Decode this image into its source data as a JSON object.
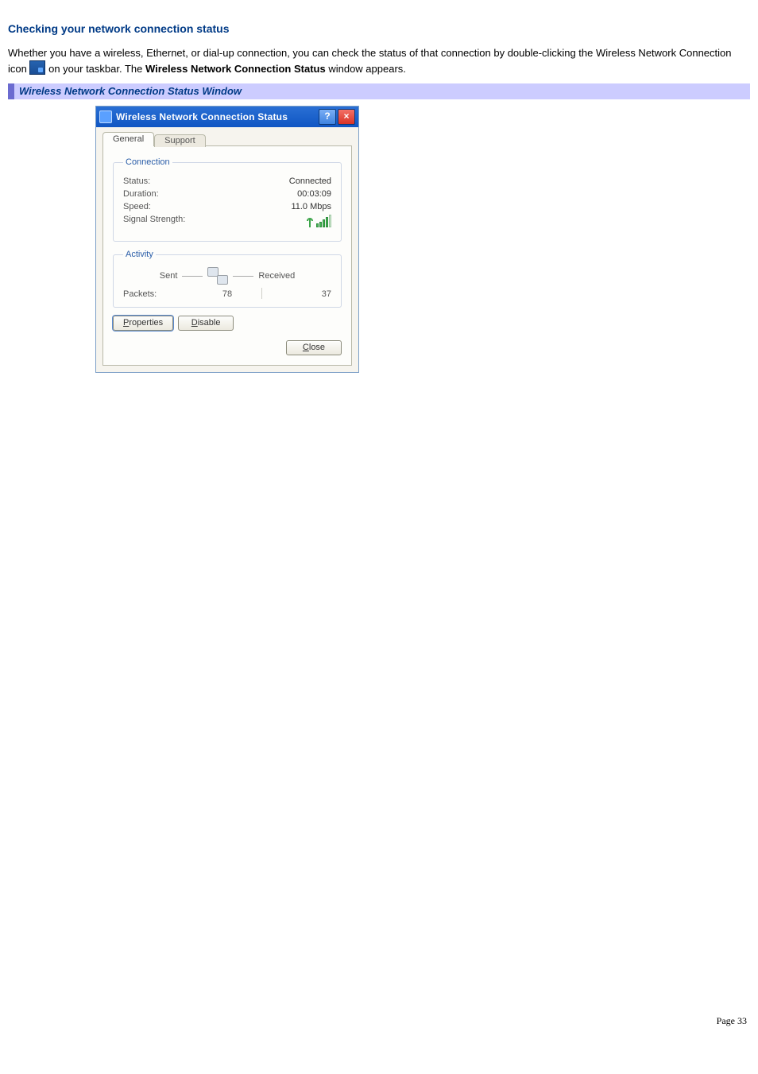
{
  "section_title": "Checking your network connection status",
  "paragraph": {
    "pre": "Whether you have a wireless, Ethernet, or dial-up connection, you can check the status of that connection by double-clicking the Wireless Network Connection icon ",
    "post1": " on your taskbar. The ",
    "bold": "Wireless Network Connection Status",
    "post2": " window appears."
  },
  "banner": "Wireless Network Connection Status Window",
  "dialog": {
    "title": "Wireless Network Connection Status",
    "help": "?",
    "close": "×",
    "tabs": {
      "general": "General",
      "support": "Support"
    },
    "connection": {
      "legend": "Connection",
      "status": {
        "label": "Status:",
        "value": "Connected"
      },
      "duration": {
        "label": "Duration:",
        "value": "00:03:09"
      },
      "speed": {
        "label": "Speed:",
        "value": "11.0 Mbps"
      },
      "signal": {
        "label": "Signal Strength:"
      }
    },
    "activity": {
      "legend": "Activity",
      "sent": "Sent",
      "received": "Received",
      "packets": {
        "label": "Packets:",
        "sent": "78",
        "received": "37"
      }
    },
    "buttons": {
      "properties": "Properties",
      "disable": "Disable",
      "close": "Close"
    }
  },
  "page_number": "Page 33"
}
